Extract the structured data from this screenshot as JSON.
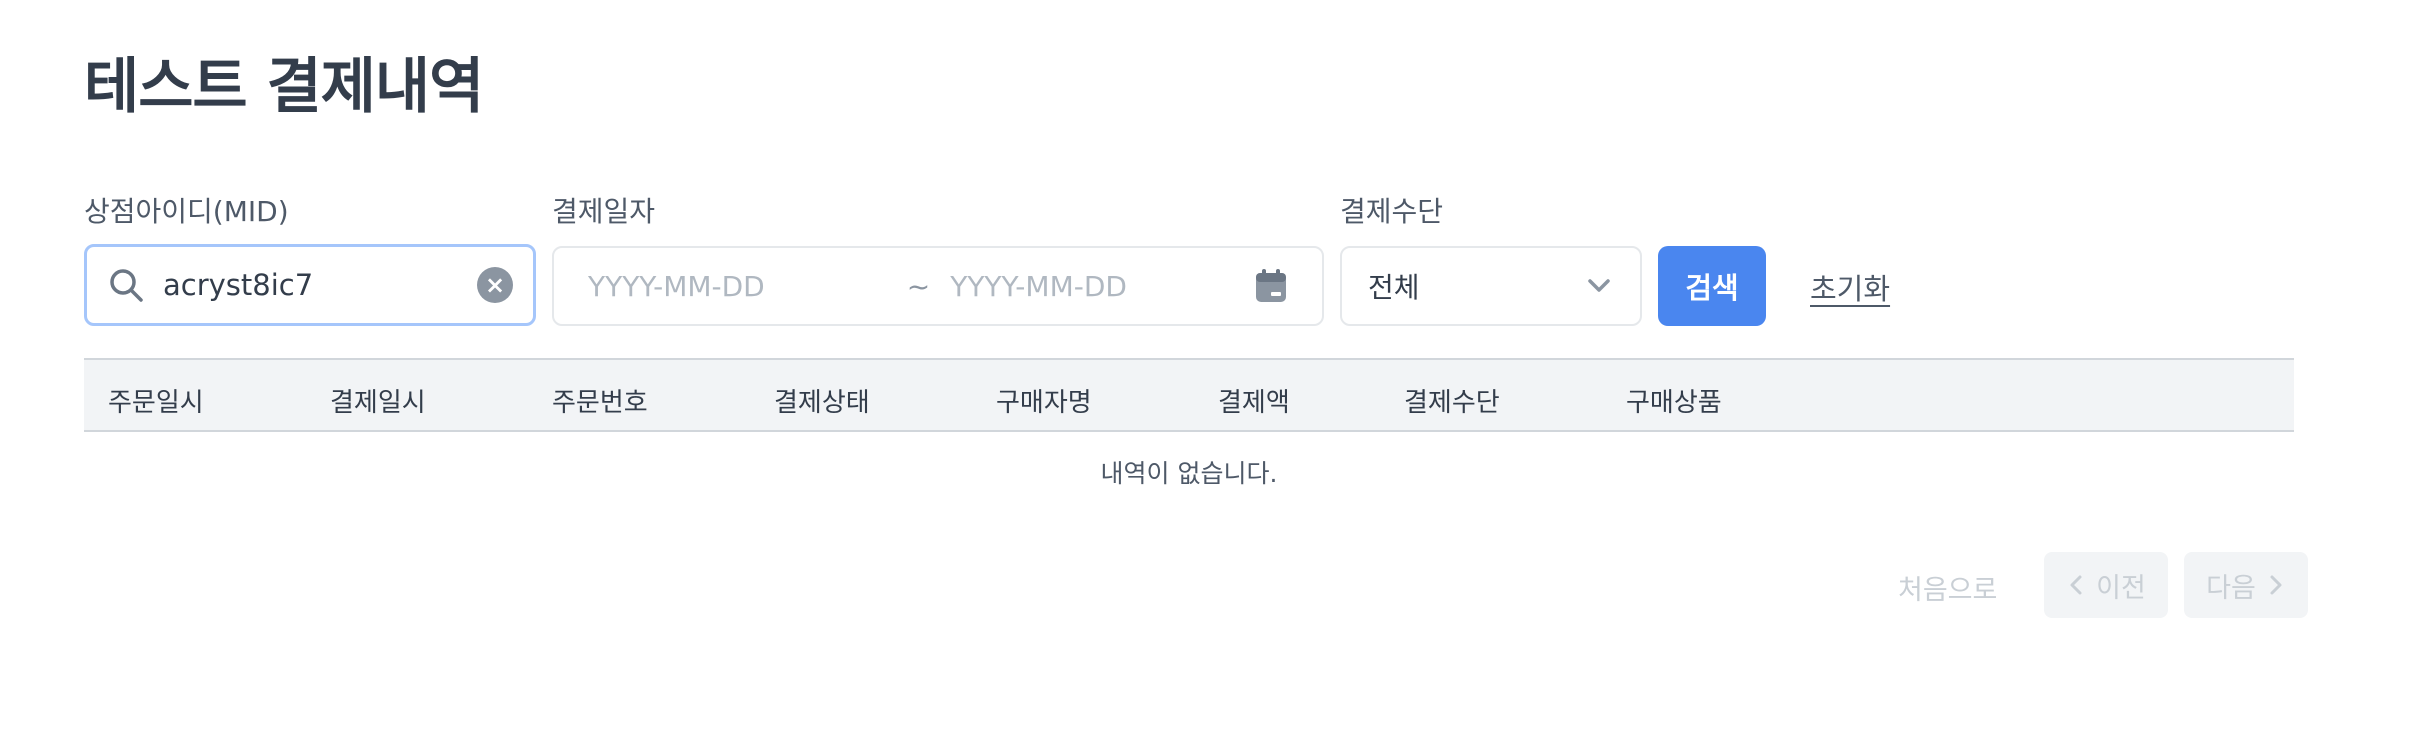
{
  "page": {
    "title": "테스트 결제내역"
  },
  "filters": {
    "mid": {
      "label": "상점아이디(MID)",
      "value": "acryst8ic7",
      "icon": "search-icon",
      "clear_icon": "clear-icon"
    },
    "date": {
      "label": "결제일자",
      "start_placeholder": "YYYY-MM-DD",
      "separator": "~",
      "end_placeholder": "YYYY-MM-DD",
      "icon": "calendar-icon"
    },
    "method": {
      "label": "결제수단",
      "selected": "전체",
      "icon": "chevron-down-icon"
    },
    "search_label": "검색",
    "reset_label": "초기화"
  },
  "table": {
    "columns": [
      "주문일시",
      "결제일시",
      "주문번호",
      "결제상태",
      "구매자명",
      "결제액",
      "결제수단",
      "구매상품"
    ],
    "rows": [],
    "empty_message": "내역이 없습니다."
  },
  "pagination": {
    "first_label": "처음으로",
    "prev_label": "이전",
    "next_label": "다음"
  },
  "colors": {
    "primary": "#4a86ef",
    "focus_border": "#a5c6fb",
    "header_bg": "#f2f4f6",
    "text": "#333d4b",
    "disabled": "#c9cfd5"
  }
}
